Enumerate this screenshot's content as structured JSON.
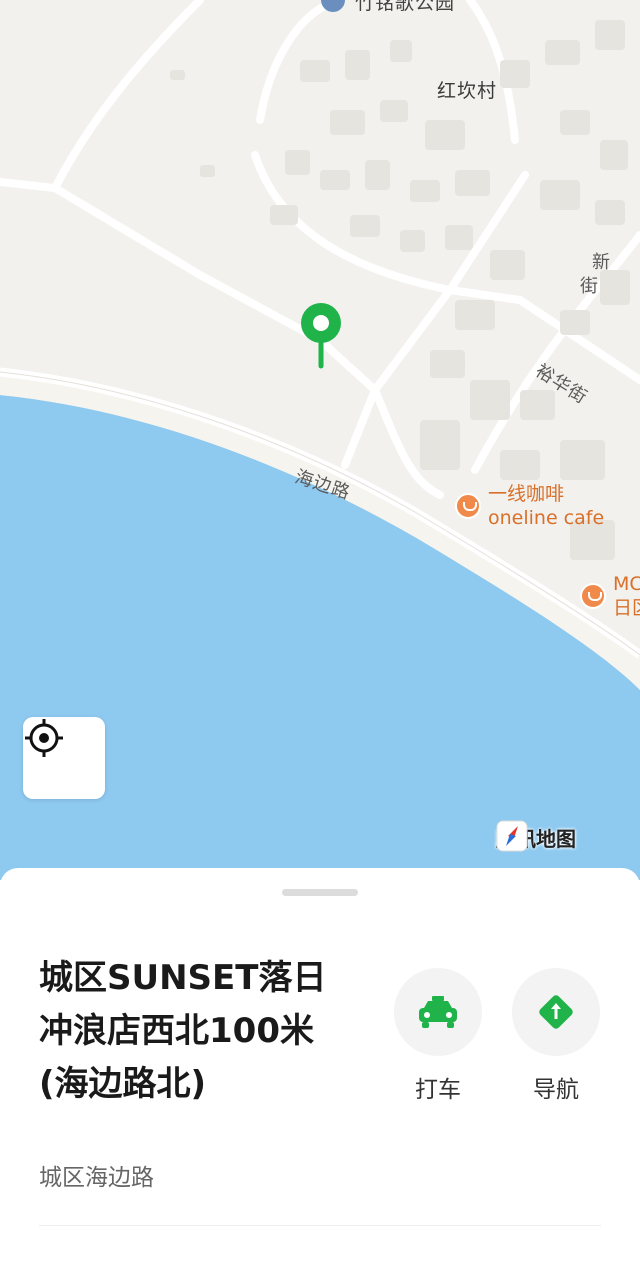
{
  "map": {
    "labels": {
      "top_partial": "竹铭歌公园",
      "village": "红坎村",
      "new_street_1": "新",
      "new_street_2": "街",
      "yuhua_street": "裕华街",
      "haibian_road": "海边路"
    },
    "pois": {
      "cafe_cn": "一线咖啡",
      "cafe_en": "oneline cafe",
      "partial_1": "MC",
      "partial_2": "日区"
    },
    "brand": "腾讯地图",
    "colors": {
      "water": "#8ec9f0",
      "land": "#f2f1ee",
      "pin": "#1fb34a",
      "poi": "#d9702a"
    }
  },
  "sheet": {
    "title": "城区SUNSET落日冲浪店西北100米(海边路北)",
    "subtitle": "城区海边路",
    "actions": {
      "taxi": "打车",
      "navigate": "导航"
    },
    "accent": "#1fb34a"
  }
}
